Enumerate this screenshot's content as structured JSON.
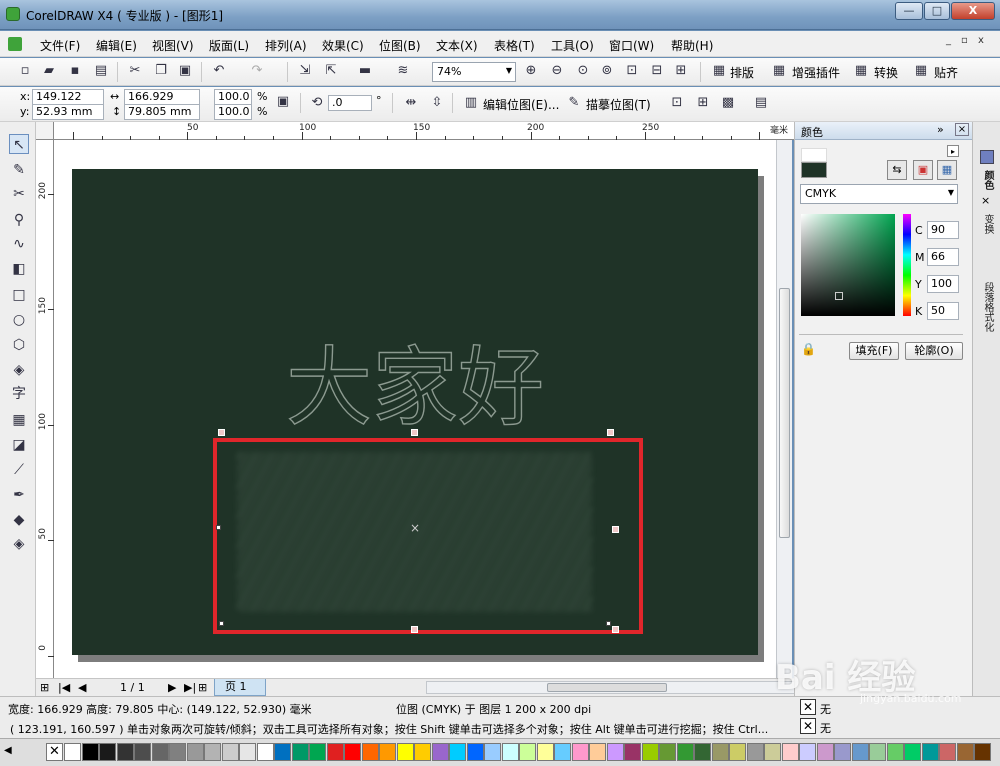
{
  "window": {
    "title": "CorelDRAW X4 ( 专业版 ) - [图形1]",
    "buttons": {
      "minimize": "—",
      "maximize": "□",
      "close": "X"
    }
  },
  "menu": {
    "items": [
      "文件(F)",
      "编辑(E)",
      "视图(V)",
      "版面(L)",
      "排列(A)",
      "效果(C)",
      "位图(B)",
      "文本(X)",
      "表格(T)",
      "工具(O)",
      "窗口(W)",
      "帮助(H)"
    ],
    "mdi_buttons": [
      "_",
      "▫",
      "x"
    ]
  },
  "toolbar_standard": {
    "zoom": "74%",
    "plugins": [
      "排版",
      "增强插件",
      "转换",
      "贴齐"
    ]
  },
  "property_bar": {
    "x_label": "x:",
    "x_value": "149.122 mm",
    "y_label": "y:",
    "y_value": "52.93 mm",
    "width_value": "166.929 mm",
    "height_value": "79.805 mm",
    "scale_x": "100.0",
    "scale_y": "100.0",
    "percent": "%",
    "rotation": ".0",
    "degree": "°",
    "edit_bitmap_label": "编辑位图(E)...",
    "trace_bitmap_label": "描摹位图(T)"
  },
  "ruler": {
    "unit": "毫米",
    "top_labels": [
      "50",
      "100",
      "150",
      "200",
      "250"
    ],
    "left_labels": [
      "200",
      "150",
      "100",
      "50",
      "0"
    ]
  },
  "canvas": {
    "page_color": "#1f3327",
    "text_object": "大家好",
    "selection_color": "#e0262b"
  },
  "pagebar": {
    "page_count": "1 / 1",
    "page_tab": "页 1"
  },
  "docker": {
    "title": "颜色",
    "model": "CMYK",
    "c_label": "C",
    "c_value": "90",
    "m_label": "M",
    "m_value": "66",
    "y_label": "Y",
    "y_value": "100",
    "k_label": "K",
    "k_value": "50",
    "fill_button": "填充(F)",
    "outline_button": "轮廓(O)",
    "current_color": "#1f3327",
    "side_tabs": [
      "颜色",
      "变换",
      "段落格式化"
    ]
  },
  "status": {
    "line1": "宽度: 166.929  高度: 79.805  中心: (149.122, 52.930)  毫米",
    "line1_right": "位图 (CMYK) 于 图层 1 200 x 200 dpi",
    "line2": "( 123.191, 160.597 )    单击对象两次可旋转/倾斜；双击工具可选择所有对象；按住 Shift 键单击可选择多个对象；按住 Alt 键单击可进行挖掘；按住 Ctrl...",
    "fill_label": "无",
    "outline_label": "无"
  },
  "palette": {
    "colors": [
      "#ffffff",
      "#000000",
      "#1a1a1a",
      "#333333",
      "#4d4d4d",
      "#666666",
      "#808080",
      "#999999",
      "#b3b3b3",
      "#cccccc",
      "#e6e6e6",
      "#ffffff",
      "#0070c0",
      "#009966",
      "#00a650",
      "#e02020",
      "#ff0000",
      "#ff6600",
      "#ff9900",
      "#ffff00",
      "#ffcc00",
      "#9966cc",
      "#00ccff",
      "#0066ff",
      "#99ccff",
      "#ccffff",
      "#ccff99",
      "#ffff99",
      "#66ccff",
      "#ff99cc",
      "#ffcc99",
      "#cc99ff",
      "#993366",
      "#99cc00",
      "#669933",
      "#339933",
      "#336633",
      "#999966",
      "#cccc66",
      "#999999",
      "#cccc99",
      "#ffcccc",
      "#ccccff",
      "#cc99cc",
      "#9999cc",
      "#6699cc",
      "#99cc99",
      "#66cc66",
      "#00cc66",
      "#009999",
      "#cc6666",
      "#996633",
      "#663300",
      "#cc9966"
    ]
  },
  "watermark": {
    "text": "Bai 经验",
    "url": "jingyan.baidu.com"
  }
}
